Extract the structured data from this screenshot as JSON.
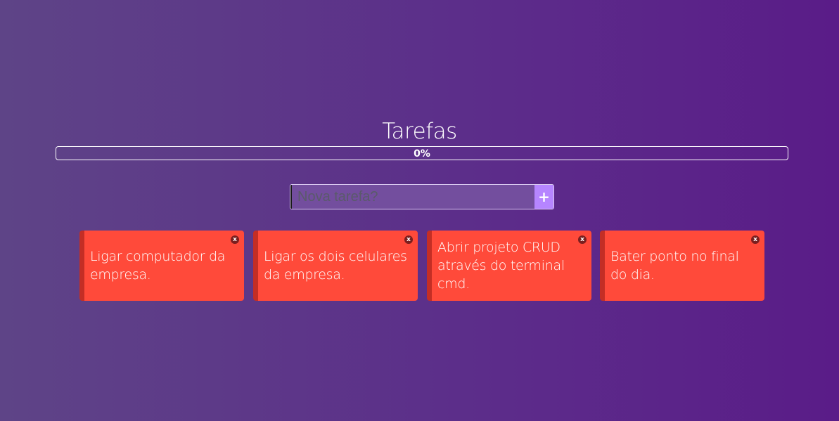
{
  "header": {
    "title": "Tarefas"
  },
  "progress": {
    "value": 0,
    "label": "0%"
  },
  "add_form": {
    "placeholder": "Nova tarefa?",
    "value": "",
    "button_label": "+"
  },
  "tasks": [
    {
      "text": "Ligar computador da empresa.",
      "close_label": "x"
    },
    {
      "text": "Ligar os dois celulares da empresa.",
      "close_label": "x"
    },
    {
      "text": "Abrir projeto CRUD através do terminal cmd.",
      "close_label": "x"
    },
    {
      "text": "Bater ponto no final do dia.",
      "close_label": "x"
    }
  ],
  "colors": {
    "card_background": "#ff4a3a",
    "card_accent": "#c42e25",
    "add_button": "#b685ff",
    "background_start": "#5e4487",
    "background_end": "#5a1c88"
  }
}
